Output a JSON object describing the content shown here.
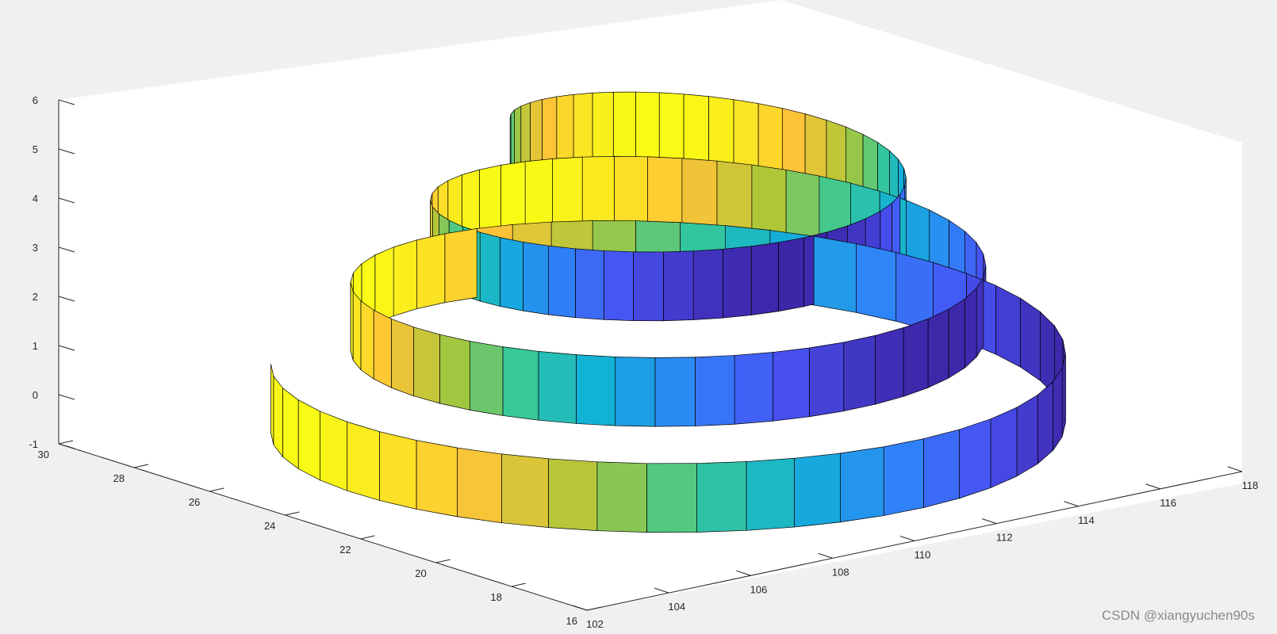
{
  "chart_data": {
    "type": "surface3d",
    "title": "",
    "xlabel": "",
    "ylabel": "",
    "zlabel": "",
    "x_ticks": [
      "102",
      "104",
      "106",
      "108",
      "110",
      "112",
      "114",
      "116",
      "118"
    ],
    "y_ticks": [
      "16",
      "18",
      "20",
      "22",
      "24",
      "26",
      "28",
      "30"
    ],
    "z_ticks": [
      "-1",
      "0",
      "1",
      "2",
      "3",
      "4",
      "5",
      "6"
    ],
    "xlim": [
      102,
      118
    ],
    "ylim": [
      16,
      30
    ],
    "zlim": [
      -1,
      6
    ],
    "colormap": "parula",
    "edge_color": "#000000",
    "surface": {
      "description_type": "spiral ribbon",
      "center": [
        110,
        22
      ],
      "radius_start": 7.5,
      "radius_end": 3.2,
      "turns": 3,
      "z_start": -0.6,
      "z_end": 4.6,
      "ribbon_height": 1.4
    },
    "grid": false,
    "box": true
  },
  "watermark": "CSDN @xiangyuchen90s"
}
